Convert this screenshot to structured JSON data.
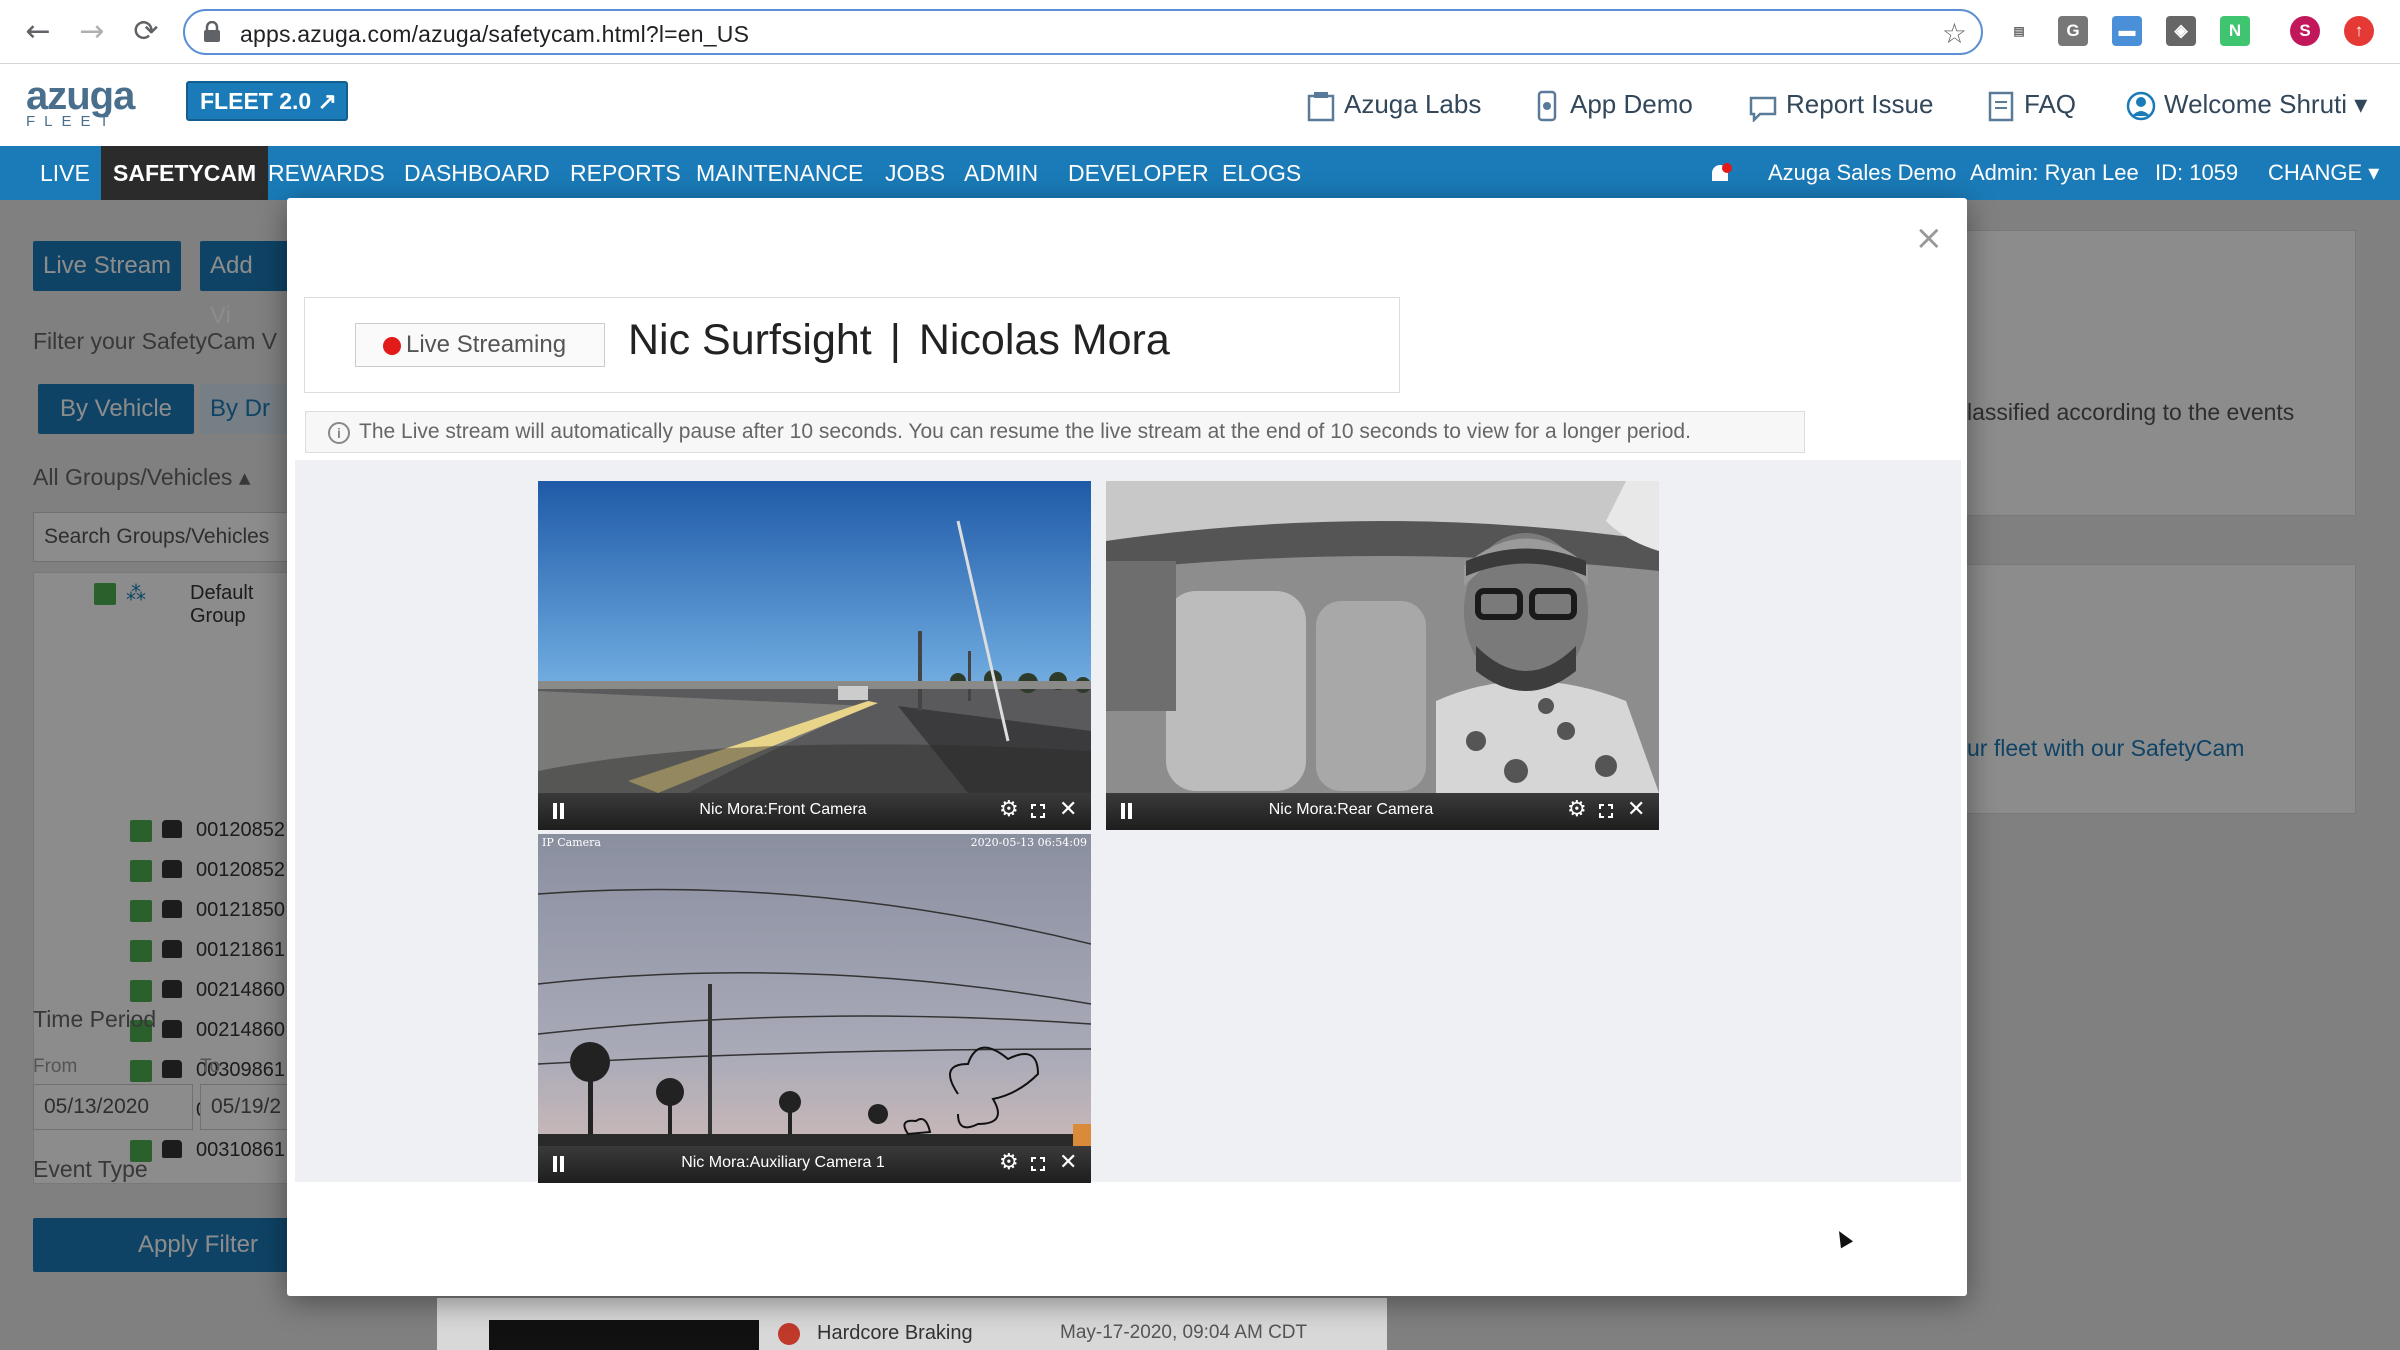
{
  "browser": {
    "url": "apps.azuga.com/azuga/safetycam.html?l=en_US",
    "back": "←",
    "forward": "→",
    "reload": "⟳",
    "star": "☆",
    "profile_initial": "S"
  },
  "header": {
    "logo_main": "azuga",
    "logo_sub": "FLEET",
    "fleet_button": "FLEET 2.0",
    "links": {
      "labs": "Azuga Labs",
      "demo": "App Demo",
      "report": "Report Issue",
      "faq": "FAQ",
      "welcome": "Welcome Shruti ▾"
    }
  },
  "nav": {
    "items": [
      "LIVE",
      "SAFETYCAM",
      "REWARDS",
      "DASHBOARD",
      "REPORTS",
      "MAINTENANCE",
      "JOBS",
      "ADMIN",
      "DEVELOPER",
      "ELOGS"
    ],
    "active": "SAFETYCAM",
    "account": "Azuga Sales Demo",
    "admin": "Admin: Ryan Lee",
    "id": "ID: 1059",
    "change": "CHANGE ▾"
  },
  "background": {
    "live_stream_btn": "Live Stream",
    "add_video_btn": "Add Vi",
    "filter_label": "Filter your SafetyCam V",
    "by_vehicle": "By Vehicle",
    "by_driver": "By Dr",
    "groups_label": "All Groups/Vehicles ▴",
    "search_placeholder": "Search Groups/Vehicles",
    "default_group": "Default Group",
    "vehicles": [
      "00120852",
      "00120852",
      "00121850",
      "00121861",
      "00214860",
      "00214860",
      "00309861",
      "00309861",
      "00310861"
    ],
    "time_period": "Time Period",
    "from_label": "From",
    "to_label": "To",
    "from_date": "05/13/2020",
    "to_date": "05/19/2",
    "event_type": "Event Type",
    "apply_filter": "Apply Filter",
    "right_text_1": "lassified according to the events",
    "right_text_2": "ur fleet with our SafetyCam",
    "event_name": "Hardcore Braking",
    "event_time": "May-17-2020, 09:04 AM CDT"
  },
  "modal": {
    "close": "×",
    "live_badge": "Live Streaming",
    "vehicle": "Nic Surfsight",
    "separator": "|",
    "driver": "Nicolas Mora",
    "info_icon": "i",
    "info_text": "The Live stream will automatically pause after 10 seconds. You can resume the live stream at the end of 10 seconds to view for a longer period.",
    "cameras": [
      {
        "label": "Nic Mora:Front Camera"
      },
      {
        "label": "Nic Mora:Rear Camera"
      },
      {
        "label": "Nic Mora:Auxiliary Camera 1",
        "osd_left": "IP Camera",
        "osd_right": "2020-05-13 06:54:09"
      }
    ],
    "icons": {
      "gear": "⚙",
      "close": "✕"
    }
  },
  "colors": {
    "brand_blue": "#1a7bb8",
    "nav_active": "#2b2b2b",
    "live_red": "#e31a1a"
  }
}
